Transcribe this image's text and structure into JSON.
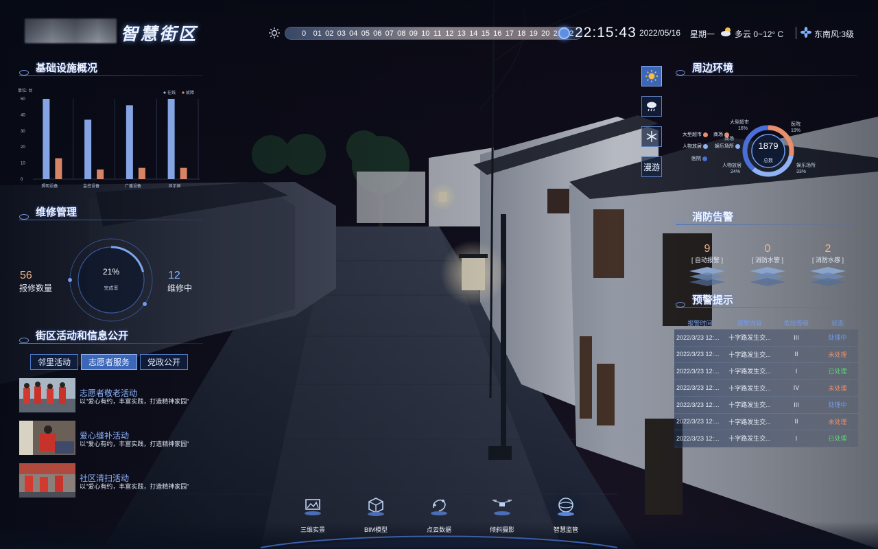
{
  "header": {
    "title": "智慧街区",
    "timeline_hours": [
      "0",
      "01",
      "02",
      "03",
      "04",
      "05",
      "06",
      "07",
      "08",
      "09",
      "10",
      "11",
      "12",
      "13",
      "14",
      "15",
      "16",
      "17",
      "18",
      "19",
      "20",
      "21",
      "22"
    ],
    "current_hour": "22",
    "clock": "22:15:43",
    "date": "2022/05/16",
    "weekday": "星期一",
    "weather": "多云 0~12° C",
    "wind": "东南风:3级"
  },
  "infra": {
    "title": "基础设施概况",
    "unit": "单位: 台",
    "legend_online": "在线",
    "legend_fault": "故障"
  },
  "chart_data": {
    "type": "bar",
    "title": "基础设施概况",
    "ylabel": "单位: 台",
    "xlabel": "",
    "categories": [
      "照明设备",
      "监控设备",
      "广播设备",
      "显示屏"
    ],
    "series": [
      {
        "name": "在线",
        "values": [
          50,
          37,
          46,
          50
        ],
        "color": "#8fb2f5"
      },
      {
        "name": "故障",
        "values": [
          13,
          6,
          7,
          7
        ],
        "color": "#e98e6c"
      }
    ],
    "ylim": [
      0,
      50
    ],
    "yticks": [
      "0",
      "10",
      "20",
      "30",
      "40",
      "50"
    ],
    "grid": false,
    "legend": "top-right"
  },
  "maintenance": {
    "title": "维修管理",
    "reported_count": "56",
    "reported_label": "报修数量",
    "repairing_count": "12",
    "repairing_label": "维修中",
    "completion_rate": "21%",
    "completion_fraction": 0.21,
    "completion_label": "完成率"
  },
  "activities": {
    "title": "街区活动和信息公开",
    "tabs": [
      "邻里活动",
      "志愿者服务",
      "党政公开"
    ],
    "active_tab": 1,
    "items": [
      {
        "title": "志愿者敬老活动",
        "desc": "以\"爱心有约，丰富实践，打造精神家园\""
      },
      {
        "title": "爱心缝补活动",
        "desc": "以\"爱心有约，丰富实践，打造精神家园\""
      },
      {
        "title": "社区清扫活动",
        "desc": "以\"爱心有约，丰富实践，打造精神家园\""
      }
    ]
  },
  "tools": {
    "sunny": "sun-icon",
    "rain": "rain-icon",
    "snow": "snowflake-icon",
    "roam": "漫游"
  },
  "environment": {
    "title": "周边环境",
    "total": "1879",
    "total_label": "总数",
    "legend": [
      {
        "name": "大型超市",
        "color": "#e98e6c"
      },
      {
        "name": "商场",
        "color": "#e98e6c"
      },
      {
        "name": "人物放居",
        "color": "#8fb2f5"
      },
      {
        "name": "娱乐场所",
        "color": "#8fb2f5"
      },
      {
        "name": "医院",
        "color": "#4a6fd8"
      }
    ],
    "segments": [
      {
        "name": "大型超市",
        "pct": "16%"
      },
      {
        "name": "商场",
        "pct": ""
      },
      {
        "name": "医院",
        "pct": "19%"
      },
      {
        "name": "人物放居",
        "pct": "24%"
      },
      {
        "name": "娱乐场所",
        "pct": "33%"
      }
    ]
  },
  "fire": {
    "title": "消防告警",
    "items": [
      {
        "count": "9",
        "label": "[ 自动报警 ]",
        "color": "#f0b489"
      },
      {
        "count": "0",
        "label": "[ 消防水警 ]",
        "color": "#f0b489"
      },
      {
        "count": "2",
        "label": "[ 消防水感 ]",
        "color": "#f0b489"
      }
    ]
  },
  "warning": {
    "title": "预警提示",
    "columns": [
      "报警时间",
      "报警内容",
      "危险等级",
      "状态"
    ],
    "rows": [
      {
        "time": "2022/3/23 12:...",
        "content": "十字路发生交...",
        "level": "III",
        "status": "处理中",
        "status_color": "#6f9cf0"
      },
      {
        "time": "2022/3/23 12:...",
        "content": "十字路发生交...",
        "level": "II",
        "status": "未处理",
        "status_color": "#e98e6c"
      },
      {
        "time": "2022/3/23 12:...",
        "content": "十字路发生交...",
        "level": "I",
        "status": "已处理",
        "status_color": "#5fd37a"
      },
      {
        "time": "2022/3/23 12:...",
        "content": "十字路发生交...",
        "level": "IV",
        "status": "未处理",
        "status_color": "#e98e6c"
      },
      {
        "time": "2022/3/23 12:...",
        "content": "十字路发生交...",
        "level": "III",
        "status": "处理中",
        "status_color": "#6f9cf0"
      },
      {
        "time": "2022/3/23 12:...",
        "content": "十字路发生交...",
        "level": "II",
        "status": "未处理",
        "status_color": "#e98e6c"
      },
      {
        "time": "2022/3/23 12:...",
        "content": "十字路发生交...",
        "level": "I",
        "status": "已处理",
        "status_color": "#5fd37a"
      }
    ]
  },
  "nav": {
    "items": [
      "三维实景",
      "BIM模型",
      "点云数据",
      "倾斜摄影",
      "智慧监管"
    ],
    "active": 4
  }
}
